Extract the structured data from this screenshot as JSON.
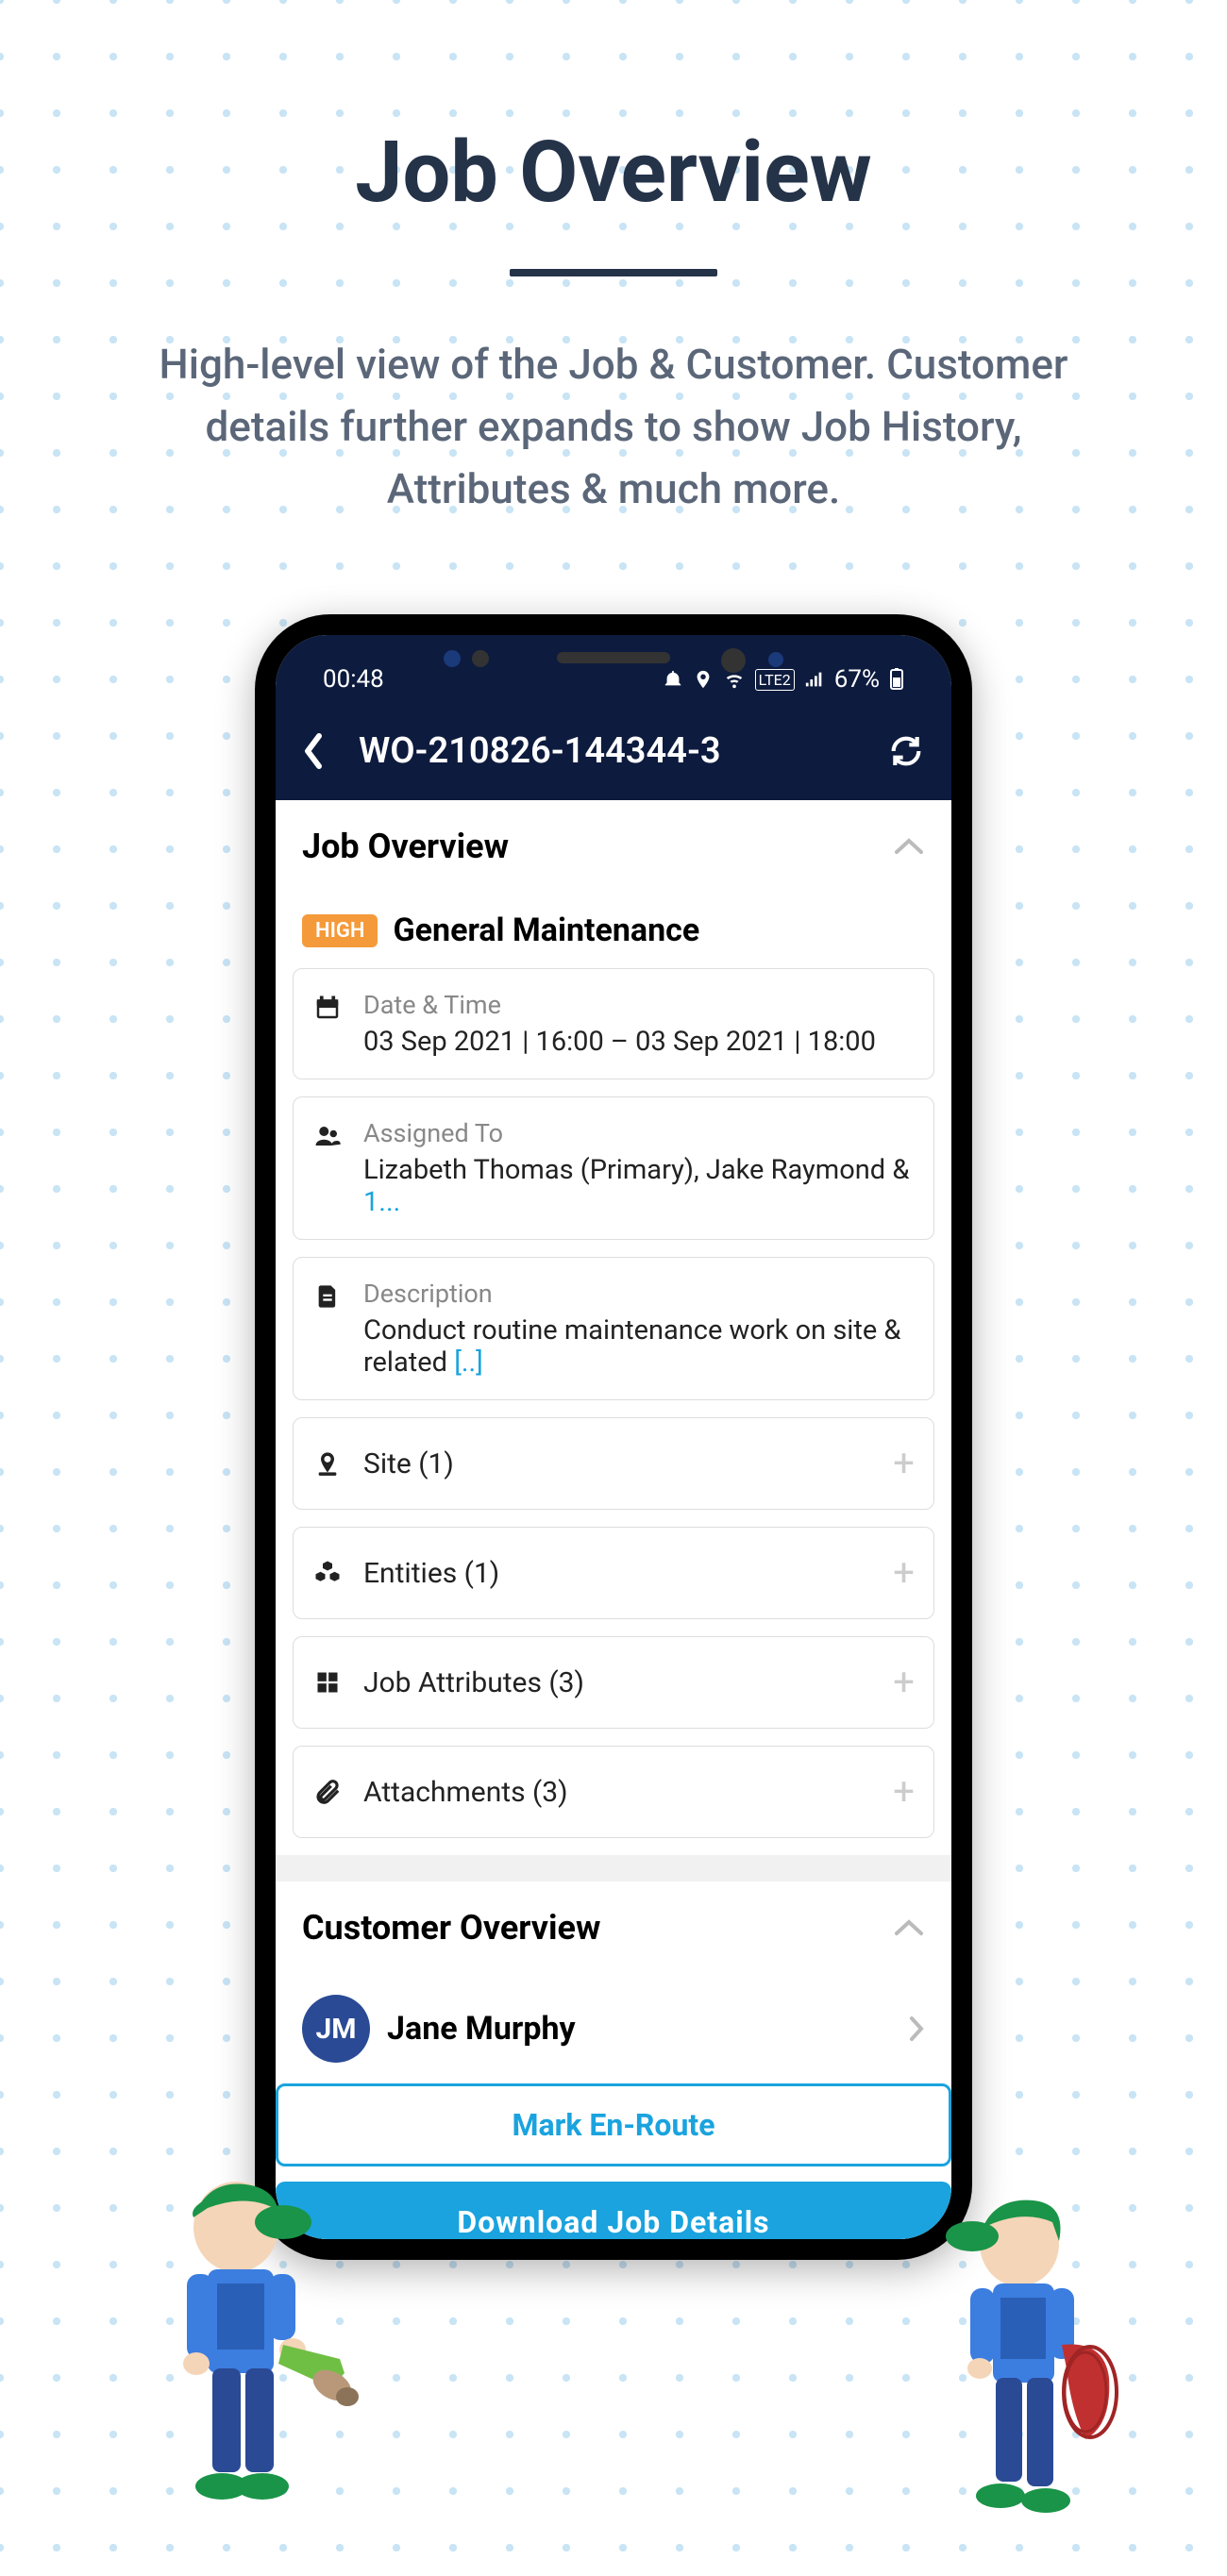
{
  "page": {
    "title": "Job Overview",
    "subtitle": "High-level view of the Job & Customer. Customer details further expands to show Job History, Attributes & much more."
  },
  "status_bar": {
    "time": "00:48",
    "battery": "67%",
    "lte": "LTE2"
  },
  "app_bar": {
    "title": "WO-210826-144344-3"
  },
  "job": {
    "section_title": "Job Overview",
    "priority": "HIGH",
    "title": "General Maintenance",
    "date_time": {
      "label": "Date & Time",
      "value": "03 Sep 2021 | 16:00  –  03 Sep 2021 | 18:00"
    },
    "assigned": {
      "label": "Assigned To",
      "value": "Lizabeth Thomas (Primary),  Jake Raymond & ",
      "more": "1..."
    },
    "description": {
      "label": "Description",
      "value": "Conduct routine maintenance work on site & related ",
      "more": "[..]"
    },
    "rows": {
      "site": "Site (1)",
      "entities": "Entities (1)",
      "attributes": "Job Attributes (3)",
      "attachments": "Attachments (3)"
    }
  },
  "customer": {
    "section_title": "Customer Overview",
    "initials": "JM",
    "name": "Jane Murphy"
  },
  "actions": {
    "mark_enroute": "Mark En-Route",
    "download": "Download Job Details"
  },
  "colors": {
    "accent": "#1aa3de",
    "dark_navy": "#0d1b3e",
    "priority_orange": "#f59a3a",
    "heading": "#253349"
  }
}
